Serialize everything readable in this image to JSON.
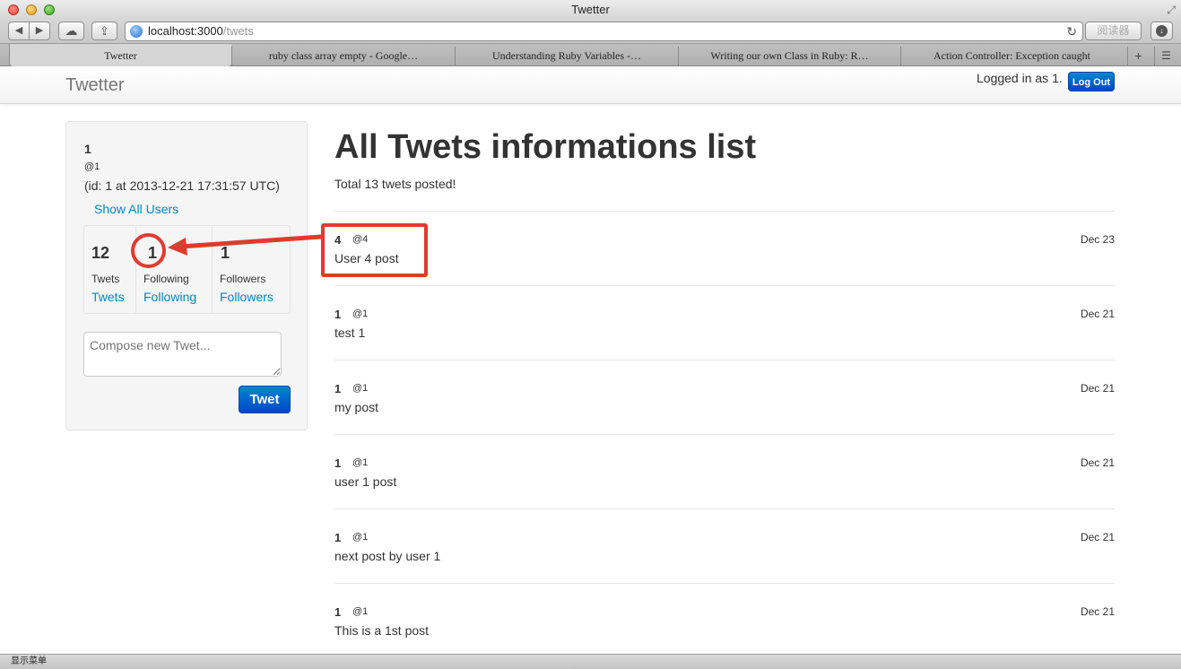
{
  "window": {
    "title": "Twetter"
  },
  "toolbar": {
    "back_glyph": "◀",
    "forward_glyph": "▶",
    "cloud_glyph": "☁",
    "share_glyph": "⇪",
    "reload_glyph": "↻",
    "download_glyph": "↓",
    "resize_glyph": "⤢",
    "reader_label": "阅读器"
  },
  "address": {
    "host": "localhost:3000",
    "path": "/twets"
  },
  "tabs": [
    {
      "label": "Twetter",
      "active": true
    },
    {
      "label": "ruby class array empty - Google…",
      "active": false
    },
    {
      "label": "Understanding Ruby Variables -…",
      "active": false
    },
    {
      "label": "Writing our own Class in Ruby: R…",
      "active": false
    },
    {
      "label": "Action Controller: Exception caught",
      "active": false
    }
  ],
  "tab_add_glyph": "+",
  "tab_list_glyph": "☰",
  "navbar": {
    "brand": "Twetter",
    "logged_in_text": "Logged in as 1.",
    "logout_label": "Log Out"
  },
  "sidebar": {
    "user_name": "1",
    "user_handle": "@1",
    "user_id_line": "(id: 1 at 2013-12-21 17:31:57 UTC)",
    "show_all_label": "Show All Users",
    "stats": [
      {
        "count": "12",
        "label": "Twets",
        "link": "Twets"
      },
      {
        "count": "1",
        "label": "Following",
        "link": "Following"
      },
      {
        "count": "1",
        "label": "Followers",
        "link": "Followers"
      }
    ],
    "compose_placeholder": "Compose new Twet...",
    "tweet_button": "Twet"
  },
  "main": {
    "title": "All Twets informations list",
    "total_text": "Total 13 twets posted!",
    "tweets": [
      {
        "name": "4",
        "handle": "@4",
        "date": "Dec 23",
        "body": "User 4 post"
      },
      {
        "name": "1",
        "handle": "@1",
        "date": "Dec 21",
        "body": "test 1"
      },
      {
        "name": "1",
        "handle": "@1",
        "date": "Dec 21",
        "body": "my post"
      },
      {
        "name": "1",
        "handle": "@1",
        "date": "Dec 21",
        "body": "user 1 post"
      },
      {
        "name": "1",
        "handle": "@1",
        "date": "Dec 21",
        "body": "next post by user 1"
      },
      {
        "name": "1",
        "handle": "@1",
        "date": "Dec 21",
        "body": "This is a 1st post"
      }
    ]
  },
  "statusbar": {
    "text": "显示菜单"
  },
  "colors": {
    "link": "#0088cc",
    "button": "#0055cc",
    "annotation": "#e03a2f"
  }
}
